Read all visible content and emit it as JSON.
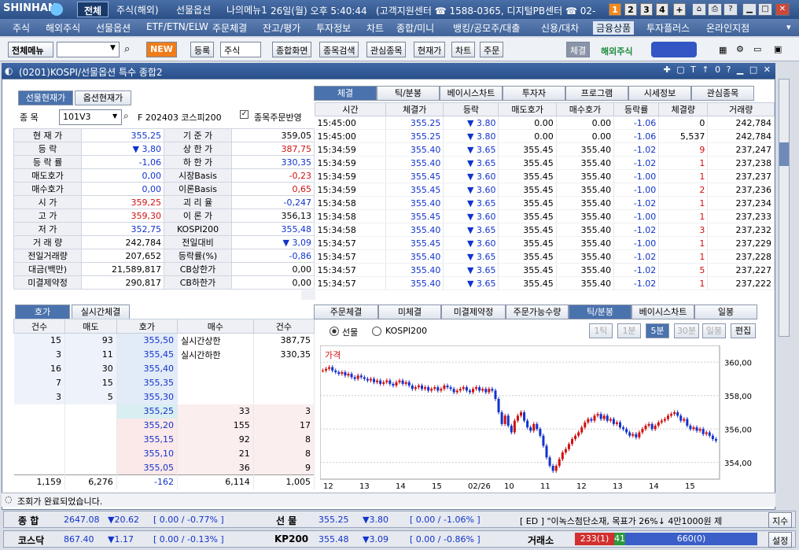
{
  "topbar": {
    "logo": "SHINHAN",
    "tabs": [
      "전체",
      "주식(해외)",
      "선물옵션",
      "나의메뉴1"
    ],
    "datetime": "26일(월) 오후 5:40:44",
    "customer": "(고객지원센터 ☎ 1588-0365, 디지털PB센터 ☎ 02-",
    "nums": [
      "1",
      "2",
      "3",
      "4"
    ]
  },
  "menu": [
    "주식",
    "해외주식",
    "선물옵션",
    "ETF/ETN/ELW",
    "주문체결",
    "잔고/평가",
    "투자정보",
    "차트",
    "종합/미니",
    "뱅킹/공모주/대출",
    "신용/대차",
    "금융상품",
    "투자플러스",
    "온라인지점"
  ],
  "toolbar": {
    "all_menu": "전체메뉴",
    "new": "NEW",
    "reg": "등록",
    "stock": "주식",
    "buttons": [
      "종합화면",
      "종목검색",
      "관심종목",
      "현재가",
      "차트",
      "주문"
    ],
    "right": [
      "체결",
      "해외주식"
    ]
  },
  "window": {
    "title": "(0201)KOSPI/선물옵션 특수 종합2"
  },
  "left_tabs": [
    "선물현재가",
    "옵션현재가"
  ],
  "code": {
    "label": "종 목",
    "value": "101V3",
    "desc": "F 202403 코스피200",
    "check": "종목주문반영"
  },
  "quote": [
    [
      "현 재 가",
      "355,25",
      "blue",
      "기 준 가",
      "359,05",
      ""
    ],
    [
      "등    락",
      "▼ 3,80",
      "blue",
      "상 한 가",
      "387,75",
      "red"
    ],
    [
      "등 락 률",
      "-1,06",
      "blue",
      "하 한 가",
      "330,35",
      "blue"
    ],
    [
      "매도호가",
      "0,00",
      "blue",
      "시장Basis",
      "-0,23",
      "red"
    ],
    [
      "매수호가",
      "0,00",
      "blue",
      "이론Basis",
      "0,65",
      "red"
    ],
    [
      "시    가",
      "359,25",
      "red",
      "괴 리 율",
      "-0,247",
      "blue"
    ],
    [
      "고    가",
      "359,30",
      "red",
      "이 론 가",
      "356,13",
      ""
    ],
    [
      "저    가",
      "352,75",
      "blue",
      "KOSPI200",
      "355,48",
      "blue"
    ],
    [
      "거 래 량",
      "242,784",
      "",
      "전일대비",
      "▼ 3,09",
      "blue"
    ],
    [
      "전일거래량",
      "207,652",
      "",
      "등락률(%)",
      "-0,86",
      "blue"
    ],
    [
      "대금(백만)",
      "21,589,817",
      "",
      "CB상한가",
      "0,00",
      ""
    ],
    [
      "미결제약정",
      "290,817",
      "",
      "CB하한가",
      "0,00",
      ""
    ]
  ],
  "right_tabs": [
    "체결",
    "틱/분봉",
    "베이시스차트",
    "투자자",
    "프로그램",
    "시세정보",
    "관심종목"
  ],
  "trade_headers": [
    "시간",
    "체결가",
    "등락",
    "매도호가",
    "매수호가",
    "등락률",
    "체결량",
    "거래량"
  ],
  "trades": [
    [
      "15:45:00",
      "355.25",
      "3.80",
      "0.00",
      "0.00",
      "-1.06",
      "0",
      "242,784"
    ],
    [
      "15:45:00",
      "355.25",
      "3.80",
      "0.00",
      "0.00",
      "-1.06",
      "5,537",
      "242,784"
    ],
    [
      "15:34:59",
      "355.40",
      "3.65",
      "355.45",
      "355.40",
      "-1.02",
      "9",
      "237,247"
    ],
    [
      "15:34:59",
      "355.40",
      "3.65",
      "355.45",
      "355.40",
      "-1.02",
      "1",
      "237,238"
    ],
    [
      "15:34:59",
      "355.45",
      "3.60",
      "355.45",
      "355.40",
      "-1.00",
      "1",
      "237,237"
    ],
    [
      "15:34:59",
      "355.45",
      "3.60",
      "355.45",
      "355.40",
      "-1.00",
      "2",
      "237,236"
    ],
    [
      "15:34:58",
      "355.40",
      "3.65",
      "355.45",
      "355.40",
      "-1.02",
      "1",
      "237,234"
    ],
    [
      "15:34:58",
      "355.45",
      "3.60",
      "355.45",
      "355.40",
      "-1.00",
      "1",
      "237,233"
    ],
    [
      "15:34:58",
      "355.40",
      "3.65",
      "355.45",
      "355.40",
      "-1.02",
      "3",
      "237,232"
    ],
    [
      "15:34:57",
      "355.45",
      "3.60",
      "355.45",
      "355.40",
      "-1.00",
      "1",
      "237,229"
    ],
    [
      "15:34:57",
      "355.40",
      "3.65",
      "355.45",
      "355.40",
      "-1.02",
      "1",
      "237,228"
    ],
    [
      "15:34:57",
      "355.40",
      "3.65",
      "355.45",
      "355.40",
      "-1.02",
      "5",
      "237,227"
    ],
    [
      "15:34:57",
      "355.40",
      "3.65",
      "355.45",
      "355.40",
      "-1.02",
      "1",
      "237,222"
    ]
  ],
  "hoga_tabs": [
    "호가",
    "실시간체결"
  ],
  "hoga_headers": [
    "건수",
    "매도",
    "호가",
    "매수",
    "건수"
  ],
  "hoga_sell": [
    [
      "15",
      "93",
      "355,50"
    ],
    [
      "3",
      "11",
      "355,45"
    ],
    [
      "16",
      "30",
      "355,40"
    ],
    [
      "7",
      "15",
      "355,35"
    ],
    [
      "3",
      "5",
      "355,30"
    ]
  ],
  "hoga_buy": [
    [
      "355,25",
      "33",
      "3"
    ],
    [
      "355,20",
      "155",
      "17"
    ],
    [
      "355,15",
      "92",
      "8"
    ],
    [
      "355,10",
      "21",
      "8"
    ],
    [
      "355,05",
      "36",
      "9"
    ]
  ],
  "hoga_limits": [
    [
      "실시간상한",
      "387,75"
    ],
    [
      "실시간하한",
      "330,35"
    ]
  ],
  "hoga_total": [
    "1,159",
    "6,276",
    "-162",
    "6,114",
    "1,005"
  ],
  "chart_tabs": [
    "주문체결",
    "미체결",
    "미결제약정",
    "주문가능수량",
    "틱/분봉",
    "베이시스차트",
    "일봉"
  ],
  "chart_opts": {
    "r1": "선물",
    "r2": "KOSPI200",
    "btns": [
      "1틱",
      "1분",
      "5분",
      "30분",
      "일봉",
      "편집"
    ]
  },
  "chart_data": {
    "type": "candlestick",
    "title": "가격",
    "y_ticks": [
      "360,00",
      "358,00",
      "356,00",
      "354,00"
    ],
    "x_ticks": [
      "12",
      "13",
      "14",
      "15",
      "02/26",
      "10",
      "11",
      "12",
      "13",
      "14",
      "15"
    ],
    "ylim": [
      353,
      361
    ]
  },
  "status": "조회가 완료되었습니다.",
  "ticker1": {
    "l1": "종 합",
    "v1": "2647.08",
    "c1": "▼20.62",
    "p1": "[ 0.00 / -0.77% ]",
    "l2": "선 물",
    "v2": "355.25",
    "c2": "▼3.80",
    "p2": "[ 0.00 / -1.06% ]",
    "news": "[ ED ] \"이녹스첨단소재, 목표가 26%↓ 4만1000원 제",
    "btn": "지수"
  },
  "ticker2": {
    "l1": "코스닥",
    "v1": "867.40",
    "c1": "▼1.17",
    "p1": "[ 0.00 / -0.13% ]",
    "l2": "KP200",
    "v2": "355.48",
    "c2": "▼3.09",
    "p2": "[ 0.00 / -0.86% ]",
    "l3": "거래소",
    "b1": "233(1)",
    "b2": "41",
    "b3": "660(0)",
    "btn": "설정"
  },
  "colors": {
    "up": "#d01010",
    "down": "#1133cc"
  }
}
